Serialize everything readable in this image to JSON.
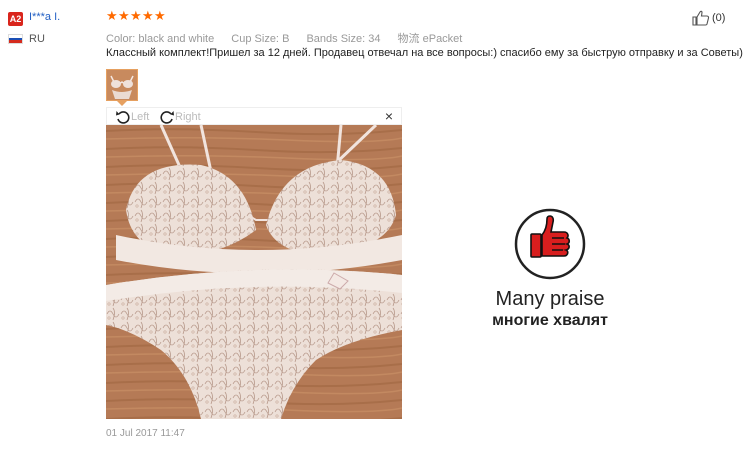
{
  "reviewer": {
    "badge": "A2",
    "name": "I***a I.",
    "country": "RU"
  },
  "rating": {
    "stars": 5,
    "max": 5
  },
  "attributes": [
    {
      "key": "Color:",
      "value": "black and white"
    },
    {
      "key": "Cup Size:",
      "value": "B"
    },
    {
      "key": "Bands Size:",
      "value": "34"
    },
    {
      "key": "物流",
      "value": "ePacket"
    }
  ],
  "helpful": {
    "count": "(0)"
  },
  "review": {
    "text": "Классный комплект!Пришел за 12 дней. Продавец отвечал на все вопросы:) спасибо ему за быструю отправку и за Советы)",
    "date": "01 Jul 2017 11:47"
  },
  "viewer": {
    "rotate_left": "Left",
    "rotate_right": "Right",
    "close": "×"
  },
  "praise": {
    "line1": "Many praise",
    "line2": "многие хвалят"
  },
  "colors": {
    "accent": "#ff6a00",
    "link": "#2360c4",
    "badge": "#d9251c",
    "praise_red": "#d81e1e"
  }
}
